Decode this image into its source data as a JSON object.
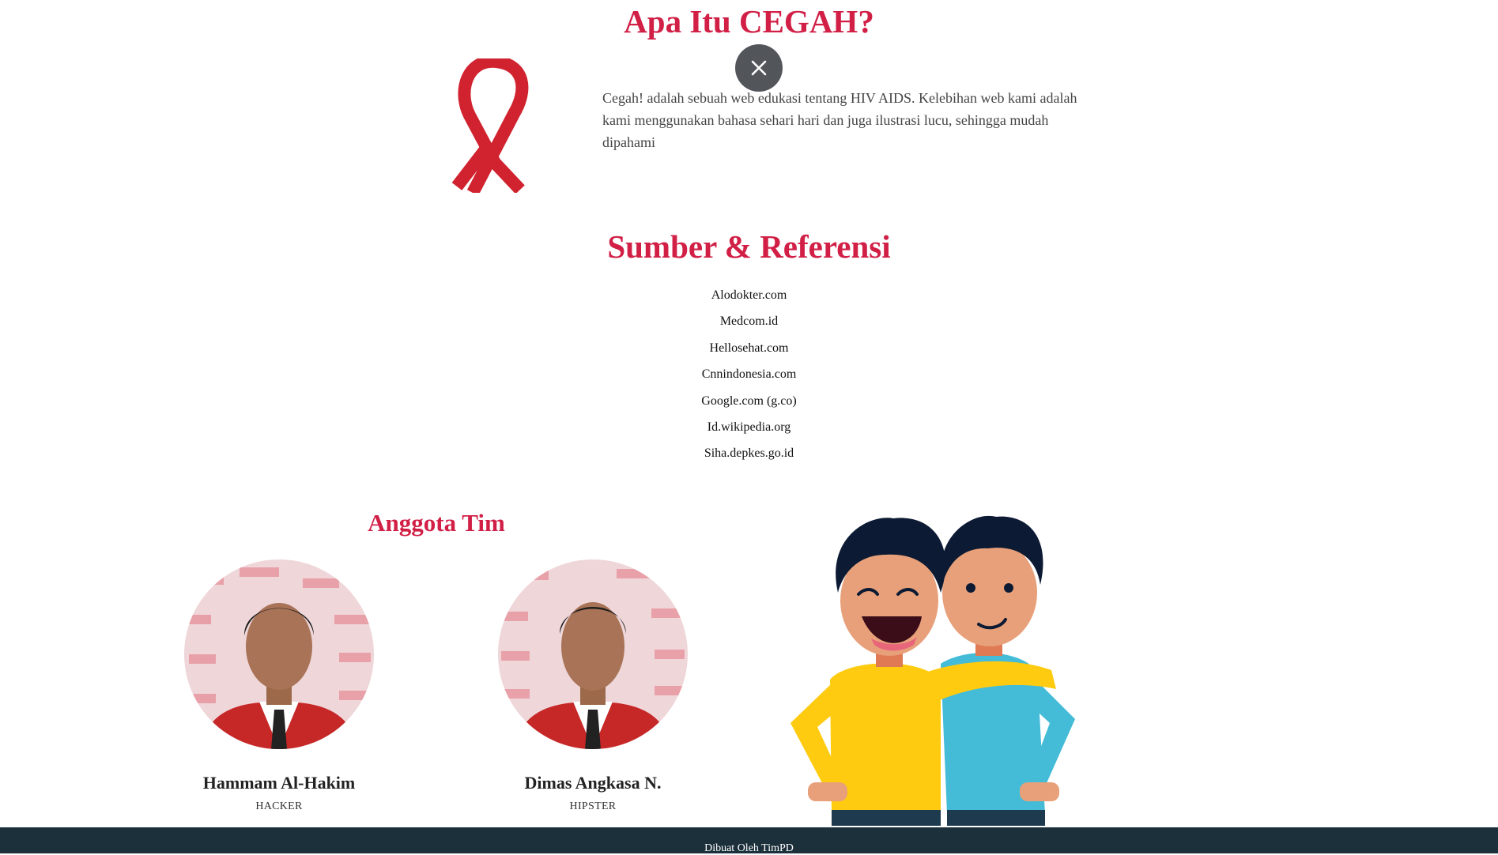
{
  "about": {
    "title": "Apa Itu CEGAH?",
    "text": "Cegah! adalah sebuah web edukasi tentang HIV AIDS. Kelebihan web kami adalah kami menggunakan bahasa sehari hari dan juga ilustrasi lucu, sehingga mudah dipahami"
  },
  "overlay": {
    "close_icon": "×"
  },
  "references": {
    "title": "Sumber & Referensi",
    "items": [
      "Alodokter.com",
      "Medcom.id",
      "Hellosehat.com",
      "Cnnindonesia.com",
      "Google.com (g.co)",
      "Id.wikipedia.org",
      "Siha.depkes.go.id"
    ]
  },
  "team": {
    "title": "Anggota Tim",
    "members": [
      {
        "name": "Hammam Al-Hakim",
        "role": "HACKER"
      },
      {
        "name": "Dimas Angkasa N.",
        "role": "HIPSTER"
      }
    ]
  },
  "footer": {
    "text": "Dibuat Oleh TimPD"
  },
  "colors": {
    "accent": "#d11f46",
    "ribbon": "#d1232f",
    "footer_bg": "#1b303b",
    "close_bg": "#52565b"
  }
}
